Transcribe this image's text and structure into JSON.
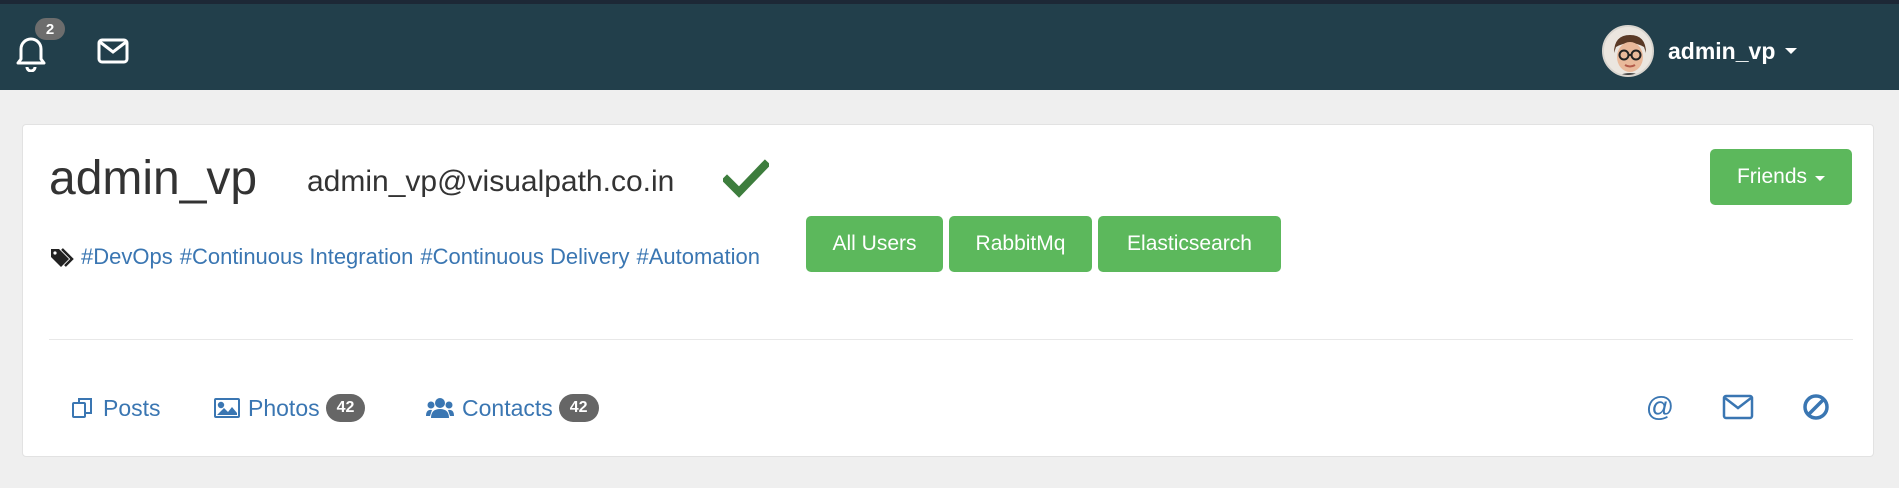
{
  "topbar": {
    "notification_count": "2",
    "user_name": "admin_vp"
  },
  "profile": {
    "name": "admin_vp",
    "email": "admin_vp@visualpath.co.in",
    "tags": [
      "#DevOps",
      "#Continuous Integration",
      "#Continuous Delivery",
      "#Automation"
    ],
    "group_buttons": [
      "All Users",
      "RabbitMq",
      "Elasticsearch"
    ],
    "friends_label": "Friends"
  },
  "tabs": {
    "posts_label": "Posts",
    "photos_label": "Photos",
    "photos_count": "42",
    "contacts_label": "Contacts",
    "contacts_count": "42"
  },
  "actions": {
    "mention_symbol": "@"
  },
  "colors": {
    "topbar": "#223f4b",
    "green": "#5cb85c",
    "link": "#3a76b2",
    "check": "#3d7d3d"
  }
}
